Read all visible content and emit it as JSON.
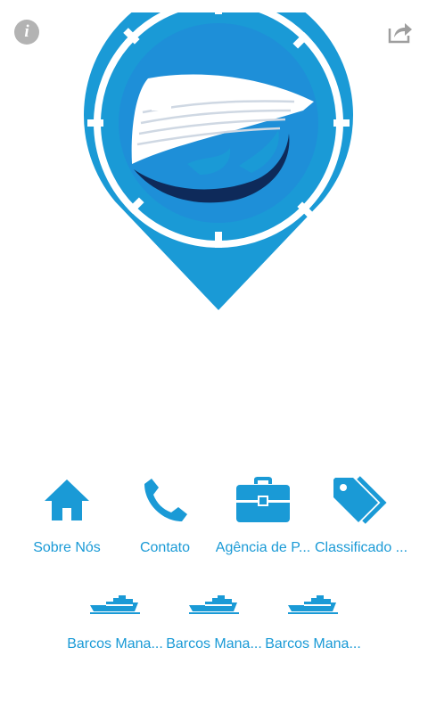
{
  "app": {
    "brand_color": "#1a9ad6",
    "dark_wave_color": "#0e2a5a"
  },
  "toolbar": {
    "info_glyph": "i",
    "info_icon": "info-icon",
    "share_icon": "share-icon"
  },
  "menu": {
    "row1": [
      {
        "label": "Sobre Nós",
        "icon": "home-icon"
      },
      {
        "label": "Contato",
        "icon": "phone-icon"
      },
      {
        "label": "Agência de P...",
        "icon": "briefcase-icon"
      },
      {
        "label": "Classificado ...",
        "icon": "tags-icon"
      }
    ],
    "row2": [
      {
        "label": "Barcos Mana...",
        "icon": "ship-icon"
      },
      {
        "label": "Barcos Mana...",
        "icon": "ship-icon"
      },
      {
        "label": "Barcos Mana...",
        "icon": "ship-icon"
      }
    ]
  }
}
